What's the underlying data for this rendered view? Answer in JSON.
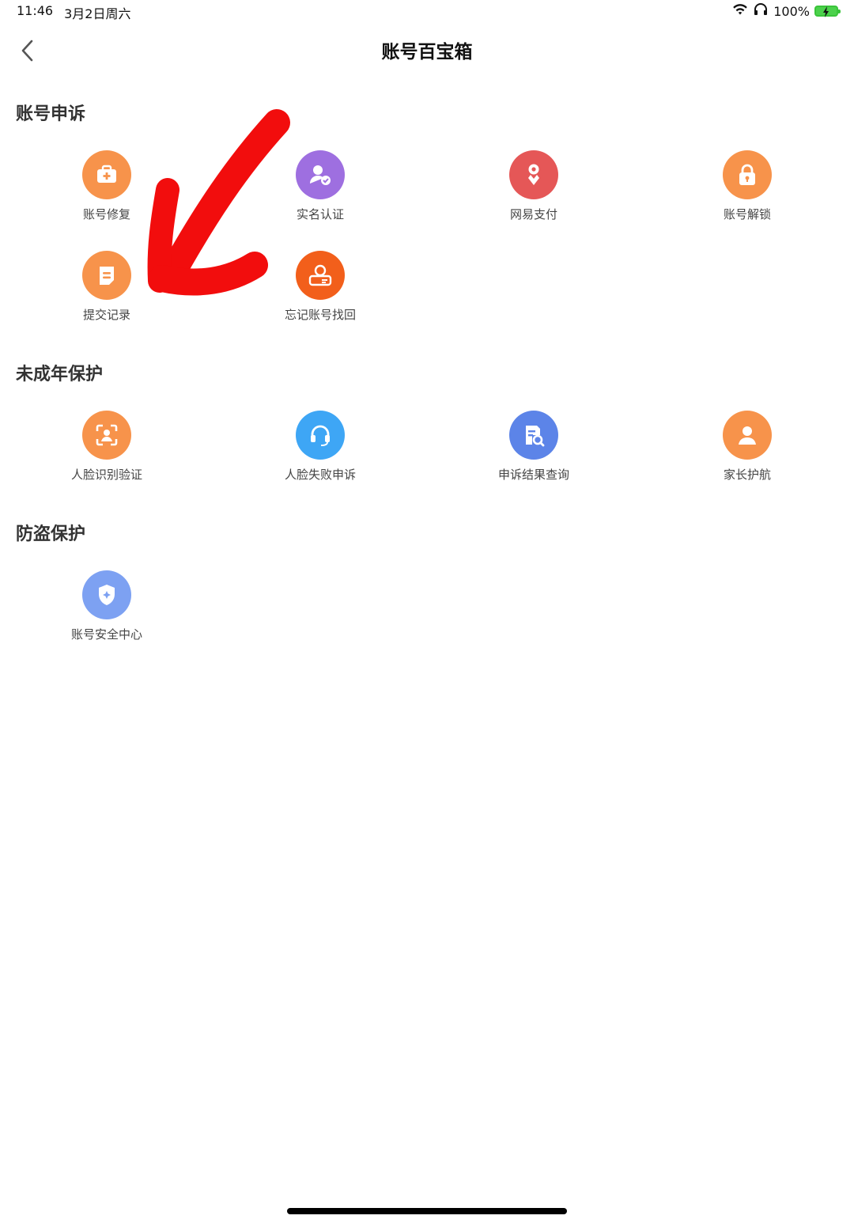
{
  "status_bar": {
    "time": "11:46",
    "date": "3月2日周六",
    "battery": "100%"
  },
  "nav": {
    "title": "账号百宝箱"
  },
  "colors": {
    "orange": "#F7934B",
    "purple": "#9E6FE0",
    "red": "#E55757",
    "deep_orange": "#F25F1B",
    "blue": "#3EA6F5",
    "indigo": "#5C84E8",
    "light_blue": "#7DA1F2",
    "annotation": "#F20D0D"
  },
  "sections": [
    {
      "title": "账号申诉",
      "items": [
        {
          "label": "账号修复",
          "icon": "medical-kit-icon",
          "color": "#F7934B"
        },
        {
          "label": "实名认证",
          "icon": "verified-user-icon",
          "color": "#9E6FE0"
        },
        {
          "label": "网易支付",
          "icon": "netease-pay-icon",
          "color": "#E55757"
        },
        {
          "label": "账号解锁",
          "icon": "lock-icon",
          "color": "#F7934B"
        },
        {
          "label": "提交记录",
          "icon": "document-icon",
          "color": "#F7934B"
        },
        {
          "label": "忘记账号找回",
          "icon": "account-card-icon",
          "color": "#F25F1B"
        }
      ]
    },
    {
      "title": "未成年保护",
      "items": [
        {
          "label": "人脸识别验证",
          "icon": "face-scan-icon",
          "color": "#F7934B"
        },
        {
          "label": "人脸失败申诉",
          "icon": "headset-icon",
          "color": "#3EA6F5"
        },
        {
          "label": "申诉结果查询",
          "icon": "search-document-icon",
          "color": "#5C84E8"
        },
        {
          "label": "家长护航",
          "icon": "parent-user-icon",
          "color": "#F7934B"
        }
      ]
    },
    {
      "title": "防盗保护",
      "items": [
        {
          "label": "账号安全中心",
          "icon": "shield-icon",
          "color": "#7DA1F2"
        }
      ]
    }
  ]
}
